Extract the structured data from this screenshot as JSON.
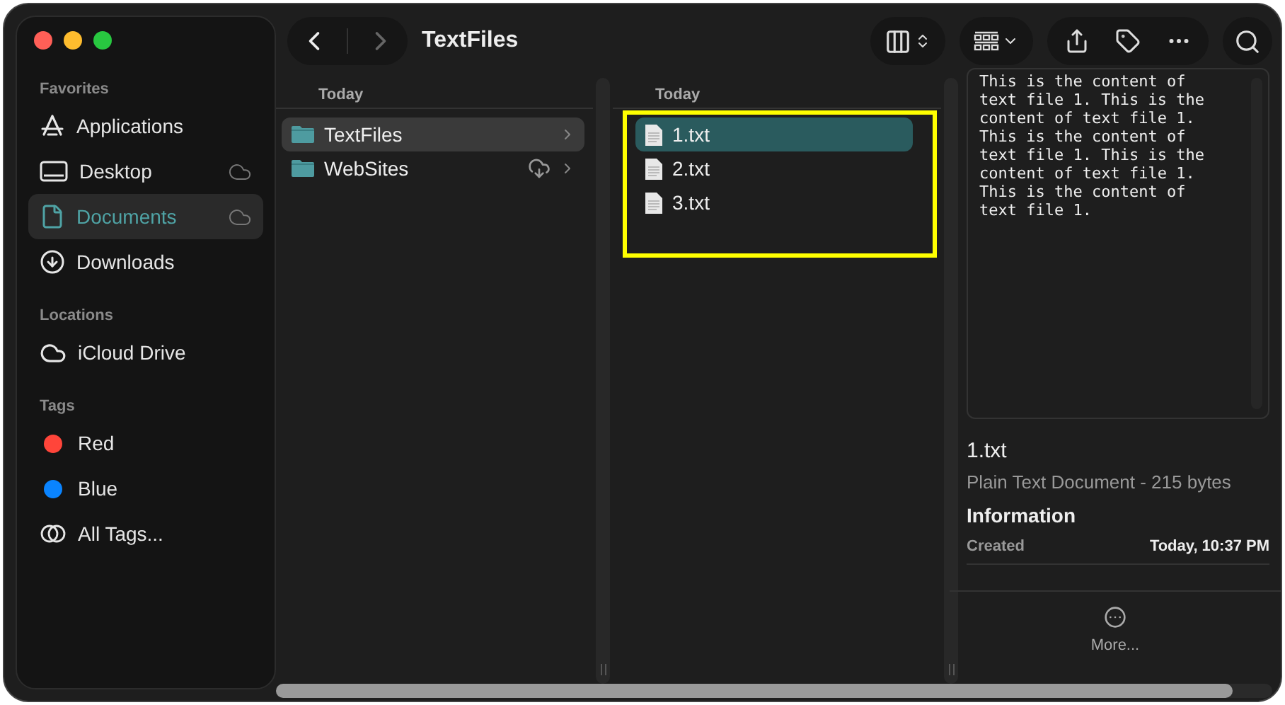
{
  "window": {
    "title": "TextFiles"
  },
  "sidebar": [
    {
      "heading": "Favorites",
      "items": [
        {
          "label": "Applications",
          "kind": "apps",
          "selected": false,
          "cloud": false
        },
        {
          "label": "Desktop",
          "kind": "desktop",
          "selected": false,
          "cloud": true
        },
        {
          "label": "Documents",
          "kind": "documents",
          "selected": true,
          "cloud": true
        },
        {
          "label": "Downloads",
          "kind": "downloads",
          "selected": false,
          "cloud": false
        }
      ]
    },
    {
      "heading": "Locations",
      "items": [
        {
          "label": "iCloud Drive",
          "kind": "icloud",
          "selected": false,
          "cloud": false
        }
      ]
    },
    {
      "heading": "Tags",
      "items": [
        {
          "label": "Red",
          "kind": "tag",
          "color": "#ff453a",
          "selected": false,
          "cloud": false
        },
        {
          "label": "Blue",
          "kind": "tag",
          "color": "#0a84ff",
          "selected": false,
          "cloud": false
        },
        {
          "label": "All Tags...",
          "kind": "alltags",
          "selected": false,
          "cloud": false
        }
      ]
    }
  ],
  "columns": [
    {
      "header": "Today",
      "highlighted": false,
      "items": [
        {
          "name": "TextFiles",
          "kind": "folder",
          "selected": true,
          "cloud": false
        },
        {
          "name": "WebSites",
          "kind": "folder",
          "selected": false,
          "cloud": true
        }
      ]
    },
    {
      "header": "Today",
      "highlighted": true,
      "items": [
        {
          "name": "1.txt",
          "kind": "file",
          "selected": true,
          "cloud": false
        },
        {
          "name": "2.txt",
          "kind": "file",
          "selected": false,
          "cloud": false
        },
        {
          "name": "3.txt",
          "kind": "file",
          "selected": false,
          "cloud": false
        }
      ]
    }
  ],
  "preview": {
    "content": "This is the content of text file 1. This is the content of text file 1. This is the content of text file 1. This is the content of text file 1. This is the content of text file 1.",
    "filename": "1.txt",
    "description": "Plain Text Document - 215 bytes",
    "info_heading": "Information",
    "rows": [
      {
        "label": "Created",
        "value": "Today, 10:37 PM"
      }
    ],
    "more_label": "More..."
  }
}
